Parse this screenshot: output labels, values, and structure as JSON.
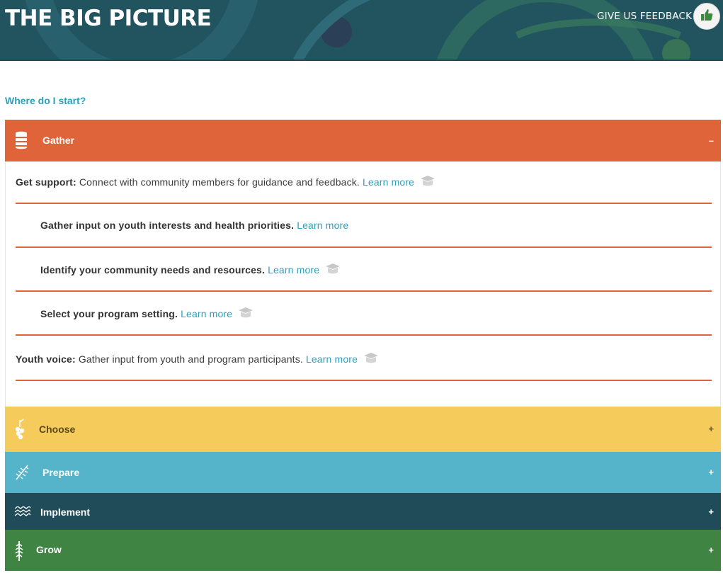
{
  "header": {
    "title": "THE BIG PICTURE",
    "feedback_label": "GIVE US FEEDBACK",
    "feedback_icon": "thumbs-up-icon"
  },
  "intro_link": "Where do I start?",
  "colors": {
    "gather": "#e0643a",
    "choose": "#f5cc5b",
    "prepare": "#55b4ca",
    "implement": "#1f4c58",
    "grow": "#408444",
    "link": "#2aa0bd"
  },
  "sections": [
    {
      "label": "Gather",
      "toggle": "–",
      "icon": "basket-icon",
      "expanded": true
    },
    {
      "label": "Choose",
      "toggle": "+",
      "icon": "berries-icon",
      "expanded": false
    },
    {
      "label": "Prepare",
      "toggle": "+",
      "icon": "herb-icon",
      "expanded": false
    },
    {
      "label": "Implement",
      "toggle": "+",
      "icon": "waves-icon",
      "expanded": false
    },
    {
      "label": "Grow",
      "toggle": "+",
      "icon": "tree-icon",
      "expanded": false
    }
  ],
  "gather_items": [
    {
      "bold": "Get support:",
      "text": " Connect with community members for guidance and feedback. ",
      "link": "Learn more",
      "badge": "cap-icon"
    },
    {
      "bold": "Gather input on youth interests and health priorities.",
      "text": " ",
      "link": "Learn more",
      "badge": ""
    },
    {
      "bold": "Identify your community needs and resources.",
      "text": " ",
      "link": "Learn more",
      "badge": "cap-icon"
    },
    {
      "bold": "Select your program setting.",
      "text": " ",
      "link": "Learn more",
      "badge": "cap-icon"
    },
    {
      "bold": "Youth voice:",
      "text": " Gather input from youth and program participants. ",
      "link": "Learn more",
      "badge": "cap-icon"
    }
  ]
}
